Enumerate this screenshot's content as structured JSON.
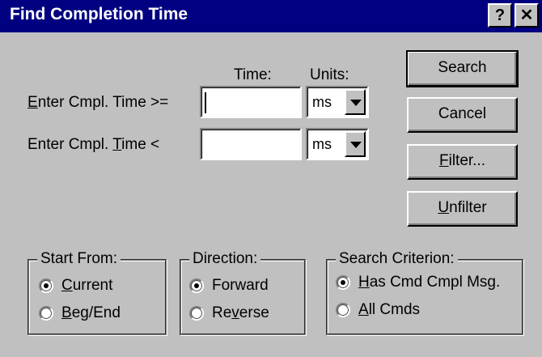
{
  "title": "Find Completion Time",
  "title_buttons": {
    "help": "?",
    "close": "✕"
  },
  "headers": {
    "time": "Time:",
    "units": "Units:"
  },
  "row1": {
    "label_pre": "",
    "label_u": "E",
    "label_post": "nter Cmpl. Time >=",
    "time_value": "",
    "units": "ms"
  },
  "row2": {
    "label_pre": "Enter Cmpl. ",
    "label_u": "T",
    "label_post": "ime <",
    "time_value": "",
    "units": "ms"
  },
  "buttons": {
    "search": "Search",
    "cancel": "Cancel",
    "filter_u": "F",
    "filter_rest": "ilter...",
    "unfilter_u": "U",
    "unfilter_rest": "nfilter"
  },
  "start_from": {
    "title": "Start From:",
    "options": [
      {
        "u": "C",
        "rest": "urrent",
        "selected": true
      },
      {
        "u": "B",
        "rest": "eg/End",
        "selected": false
      }
    ]
  },
  "direction": {
    "title": "Direction:",
    "options": [
      {
        "pre": "",
        "u": "",
        "rest": "Forward",
        "selected": true
      },
      {
        "pre": "Re",
        "u": "v",
        "rest": "erse",
        "selected": false
      }
    ]
  },
  "search_criterion": {
    "title": "Search Criterion:",
    "options": [
      {
        "u": "H",
        "rest": "as Cmd Cmpl Msg.",
        "selected": true
      },
      {
        "u": "A",
        "rest": "ll Cmds",
        "selected": false
      }
    ]
  }
}
